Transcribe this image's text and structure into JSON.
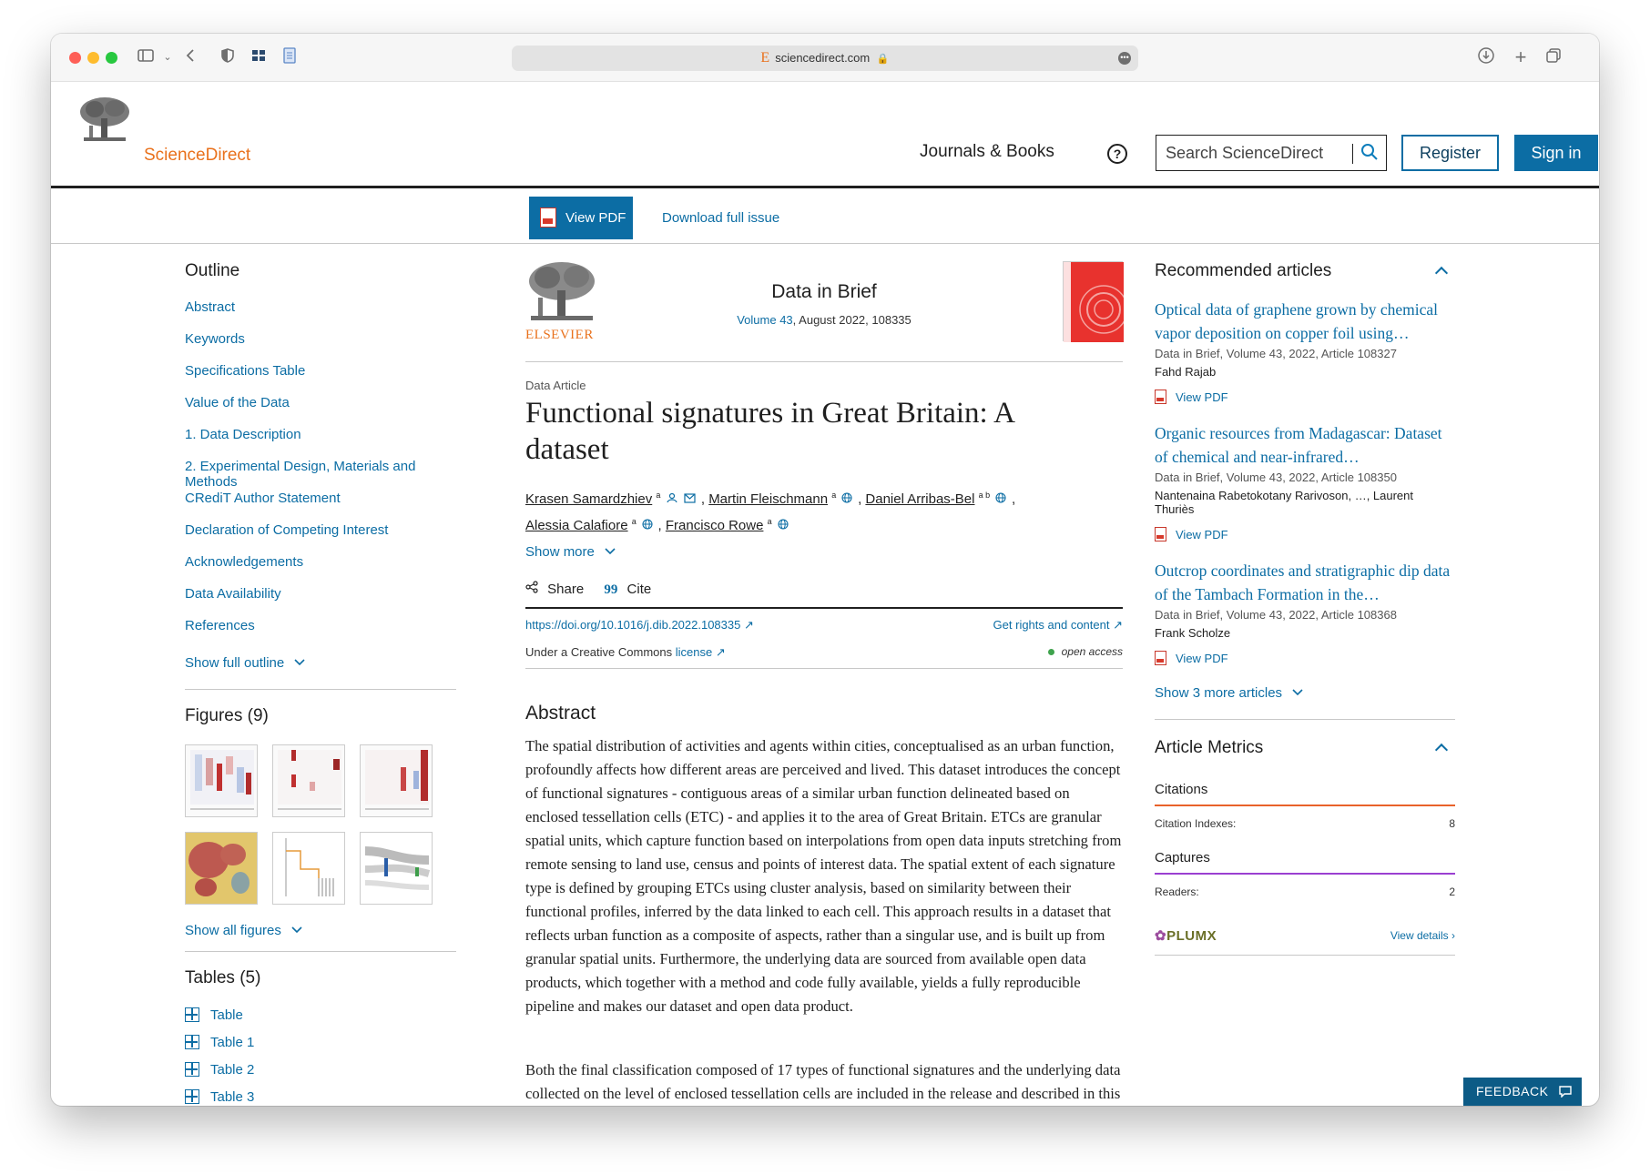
{
  "browser": {
    "url": "sciencedirect.com",
    "favicon": "E"
  },
  "header": {
    "logo": "ScienceDirect",
    "nav_journals": "Journals & Books",
    "help": "?",
    "search_placeholder": "Search ScienceDirect",
    "register": "Register",
    "sign_in": "Sign in"
  },
  "pdf_bar": {
    "view_pdf": "View PDF",
    "download_issue": "Download full issue"
  },
  "outline": {
    "title": "Outline",
    "items": [
      "Abstract",
      "Keywords",
      "Specifications Table",
      "Value of the Data",
      "1. Data Description",
      "2. Experimental Design, Materials and Methods",
      "CRediT Author Statement",
      "Declaration of Competing Interest",
      "Acknowledgements",
      "Data Availability",
      "References"
    ],
    "show_full": "Show full outline",
    "figures_title": "Figures (9)",
    "show_all_figures": "Show all figures",
    "tables_title": "Tables (5)",
    "tables": [
      "Table",
      "Table 1",
      "Table 2",
      "Table 3"
    ]
  },
  "article": {
    "journal": "Data in Brief",
    "volume_link": "Volume 43",
    "volume_rest": ", August 2022, 108335",
    "publisher": "ELSEVIER",
    "type": "Data Article",
    "title": "Functional signatures in Great Britain: A dataset",
    "authors": [
      {
        "name": "Krasen Samardzhiev",
        "sup": "a",
        "icons": "person envelope"
      },
      {
        "name": "Martin Fleischmann",
        "sup": "a",
        "icons": "globe"
      },
      {
        "name": "Daniel Arribas-Bel",
        "sup": "a b",
        "icons": "globe"
      },
      {
        "name": "Alessia Calafiore",
        "sup": "a",
        "icons": "globe"
      },
      {
        "name": "Francisco Rowe",
        "sup": "a",
        "icons": "globe"
      }
    ],
    "show_more": "Show more",
    "share": "Share",
    "cite": "Cite",
    "doi": "https://doi.org/10.1016/j.dib.2022.108335",
    "rights": "Get rights and content",
    "license_prefix": "Under a Creative Commons",
    "license_link": "license",
    "open_access": "open access",
    "abstract_heading": "Abstract",
    "abstract_p1": "The spatial distribution of activities and agents within cities, conceptualised as an urban function, profoundly affects how different areas are perceived and lived. This dataset introduces the concept of functional signatures - contiguous areas of a similar urban function delineated based on enclosed tessellation cells (ETC) - and applies it to the area of Great Britain. ETCs are granular spatial units, which capture function based on interpolations from open data inputs stretching from remote sensing to land use, census and points of interest data. The spatial extent of each signature type is defined by grouping ETCs using cluster analysis, based on similarity between their functional profiles, inferred by the data linked to each cell. This approach results in a dataset that reflects urban function as a composite of aspects, rather than a singular use, and is built up from granular spatial units. Furthermore, the underlying data are sourced from available open data products, which together with a method and code fully available, yields a fully reproducible pipeline and makes our dataset and open data product.",
    "abstract_p2": "Both the final classification composed of 17 types of functional signatures and the underlying data collected on the level of enclosed tessellation cells are included in the release and described in this report."
  },
  "recommended": {
    "title": "Recommended articles",
    "items": [
      {
        "title": "Optical data of graphene grown by chemical vapor deposition on copper foil using…",
        "meta": "Data in Brief, Volume 43, 2022, Article 108327",
        "author": "Fahd Rajab",
        "pdf": "View PDF"
      },
      {
        "title": "Organic resources from Madagascar: Dataset of chemical and near-infrared…",
        "meta": "Data in Brief, Volume 43, 2022, Article 108350",
        "author": "Nantenaina Rabetokotany Rarivoson, …, Laurent Thuriès",
        "pdf": "View PDF"
      },
      {
        "title": "Outcrop coordinates and stratigraphic dip data of the Tambach Formation in the…",
        "meta": "Data in Brief, Volume 43, 2022, Article 108368",
        "author": "Frank Scholze",
        "pdf": "View PDF"
      }
    ],
    "show_more": "Show 3 more articles"
  },
  "metrics": {
    "title": "Article Metrics",
    "citations_label": "Citations",
    "citation_indexes_label": "Citation Indexes:",
    "citation_indexes_value": "8",
    "captures_label": "Captures",
    "readers_label": "Readers:",
    "readers_value": "2",
    "plumx": "PLUMX",
    "view_details": "View details"
  },
  "feedback": "FEEDBACK",
  "colors": {
    "link": "#0c6da4",
    "brand_orange": "#e9711c",
    "citations_line": "#e9622b",
    "captures_line": "#9b3fd1"
  }
}
